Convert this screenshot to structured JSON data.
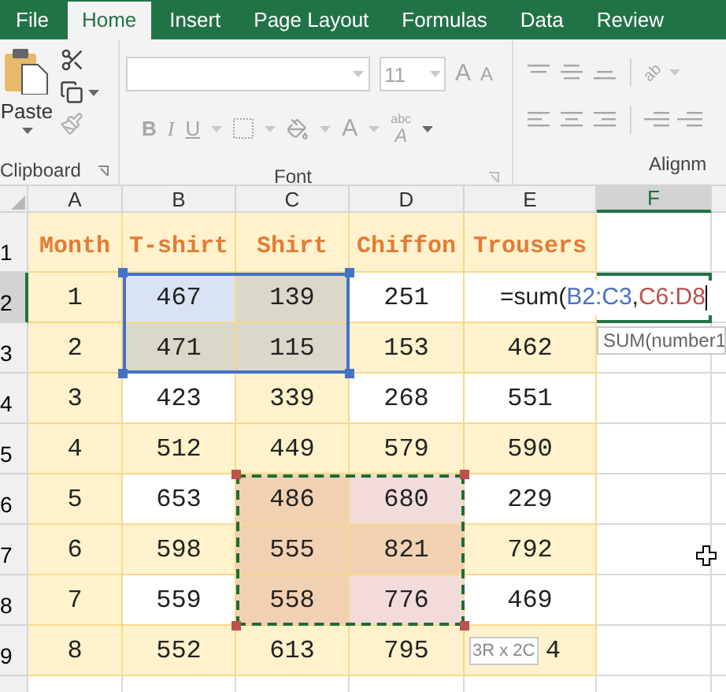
{
  "tabs": [
    {
      "label": "File",
      "selected": false
    },
    {
      "label": "Home",
      "selected": true
    },
    {
      "label": "Insert",
      "selected": false
    },
    {
      "label": "Page Layout",
      "selected": false
    },
    {
      "label": "Formulas",
      "selected": false
    },
    {
      "label": "Data",
      "selected": false
    },
    {
      "label": "Review",
      "selected": false
    }
  ],
  "ribbon": {
    "clipboard": {
      "paste": "Paste",
      "label": "Clipboard",
      "painter_disabled": true
    },
    "font": {
      "size": "11",
      "grow": "A",
      "shrink": "A",
      "bold": "B",
      "italic": "I",
      "underline": "U",
      "font_color": "A",
      "styles_top": "abc",
      "styles_bottom": "A",
      "label": "Font",
      "disabled": true
    },
    "alignment": {
      "orientation": "ab",
      "label": "Alignm",
      "disabled": true
    }
  },
  "columns": [
    {
      "label": "A",
      "selected": false
    },
    {
      "label": "B",
      "selected": false
    },
    {
      "label": "C",
      "selected": false
    },
    {
      "label": "D",
      "selected": false
    },
    {
      "label": "E",
      "selected": false
    },
    {
      "label": "F",
      "selected": true
    }
  ],
  "ranges": [
    {
      "color": "#4472c4",
      "kind": "solid"
    },
    {
      "color": "#c0504d",
      "kind": "dashed"
    }
  ],
  "rows": [
    {
      "label": "1",
      "selected": false,
      "kind": "header",
      "cells": [
        {
          "value": "Month",
          "shaded": true,
          "kind": "plain"
        },
        {
          "value": "T-shirt",
          "shaded": true,
          "kind": "plain"
        },
        {
          "value": "Shirt",
          "shaded": true,
          "kind": "plain"
        },
        {
          "value": "Chiffon",
          "shaded": true,
          "kind": "plain"
        },
        {
          "value": "Trousers",
          "shaded": true,
          "kind": "plain"
        }
      ]
    },
    {
      "label": "2",
      "selected": true,
      "kind": "data",
      "cells": [
        {
          "value": "1",
          "shaded": true,
          "kind": "plain"
        },
        {
          "value": "467",
          "shaded": false,
          "kind": "ref1"
        },
        {
          "value": "139",
          "shaded": true,
          "kind": "ref1"
        },
        {
          "value": "251",
          "shaded": false,
          "kind": "plain"
        },
        {
          "shaded": false,
          "kind": "plain"
        }
      ]
    },
    {
      "label": "3",
      "selected": false,
      "kind": "data",
      "cells": [
        {
          "value": "2",
          "shaded": true,
          "kind": "plain"
        },
        {
          "value": "471",
          "shaded": true,
          "kind": "ref1"
        },
        {
          "value": "115",
          "shaded": true,
          "kind": "ref1"
        },
        {
          "value": "153",
          "shaded": true,
          "kind": "plain"
        },
        {
          "value": "462",
          "shaded": true,
          "kind": "plain"
        }
      ]
    },
    {
      "label": "4",
      "selected": false,
      "kind": "data",
      "cells": [
        {
          "value": "3",
          "shaded": true,
          "kind": "plain"
        },
        {
          "value": "423",
          "shaded": false,
          "kind": "plain"
        },
        {
          "value": "339",
          "shaded": true,
          "kind": "plain"
        },
        {
          "value": "268",
          "shaded": false,
          "kind": "plain"
        },
        {
          "value": "551",
          "shaded": false,
          "kind": "plain"
        }
      ]
    },
    {
      "label": "5",
      "selected": false,
      "kind": "data",
      "cells": [
        {
          "value": "4",
          "shaded": true,
          "kind": "plain"
        },
        {
          "value": "512",
          "shaded": true,
          "kind": "plain"
        },
        {
          "value": "449",
          "shaded": true,
          "kind": "plain"
        },
        {
          "value": "579",
          "shaded": true,
          "kind": "plain"
        },
        {
          "value": "590",
          "shaded": true,
          "kind": "plain"
        }
      ]
    },
    {
      "label": "6",
      "selected": false,
      "kind": "data",
      "cells": [
        {
          "value": "5",
          "shaded": true,
          "kind": "plain"
        },
        {
          "value": "653",
          "shaded": false,
          "kind": "plain"
        },
        {
          "value": "486",
          "shaded": true,
          "kind": "ref2"
        },
        {
          "value": "680",
          "shaded": false,
          "kind": "ref2"
        },
        {
          "value": "229",
          "shaded": false,
          "kind": "plain"
        }
      ]
    },
    {
      "label": "7",
      "selected": false,
      "kind": "data",
      "cells": [
        {
          "value": "6",
          "shaded": true,
          "kind": "plain"
        },
        {
          "value": "598",
          "shaded": true,
          "kind": "plain"
        },
        {
          "value": "555",
          "shaded": true,
          "kind": "ref2"
        },
        {
          "value": "821",
          "shaded": true,
          "kind": "ref2"
        },
        {
          "value": "792",
          "shaded": true,
          "kind": "plain"
        }
      ]
    },
    {
      "label": "8",
      "selected": false,
      "kind": "data",
      "cells": [
        {
          "value": "7",
          "shaded": true,
          "kind": "plain"
        },
        {
          "value": "559",
          "shaded": false,
          "kind": "plain"
        },
        {
          "value": "558",
          "shaded": true,
          "kind": "ref2"
        },
        {
          "value": "776",
          "shaded": false,
          "kind": "ref2"
        },
        {
          "value": "469",
          "shaded": false,
          "kind": "plain"
        }
      ]
    },
    {
      "label": "9",
      "selected": false,
      "kind": "data",
      "cells": [
        {
          "value": "8",
          "shaded": true,
          "kind": "plain"
        },
        {
          "value": "552",
          "shaded": true,
          "kind": "plain"
        },
        {
          "value": "613",
          "shaded": true,
          "kind": "plain"
        },
        {
          "value": "795",
          "shaded": true,
          "kind": "plain"
        },
        {
          "value": "4",
          "shaded": true,
          "covered": true,
          "kind": "plain"
        }
      ]
    }
  ],
  "editor": {
    "parts": [
      {
        "text": "=sum("
      },
      {
        "text": "B2:C3",
        "color": "#4472c4"
      },
      {
        "text": ","
      },
      {
        "text": "C6:D8",
        "color": "#c0504d"
      }
    ]
  },
  "function_tip": "SUM(number1",
  "size_tip": "3R x 2C"
}
